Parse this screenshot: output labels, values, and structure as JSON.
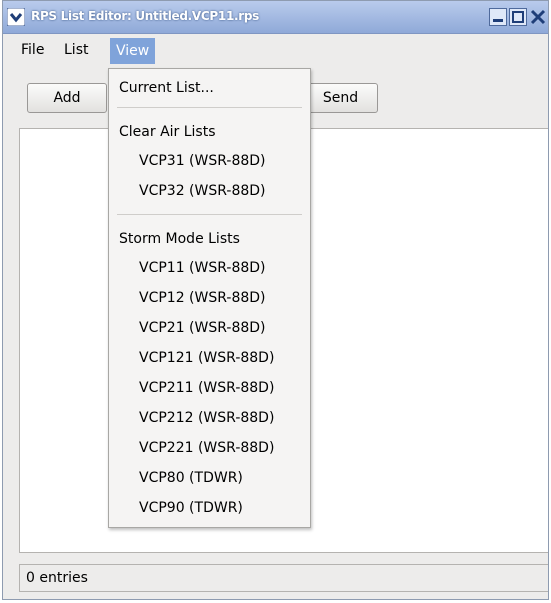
{
  "window": {
    "title": "RPS List Editor: Untitled.VCP11.rps"
  },
  "menubar": {
    "file": "File",
    "list": "List",
    "view": "View"
  },
  "toolbar": {
    "add": "Add",
    "send": "Send"
  },
  "status": {
    "text": "0 entries"
  },
  "view_menu": {
    "current_list": "Current List...",
    "clear_air_header": "Clear Air Lists",
    "clear_air_items": [
      "VCP31 (WSR-88D)",
      "VCP32 (WSR-88D)"
    ],
    "storm_mode_header": "Storm Mode Lists",
    "storm_mode_items": [
      "VCP11 (WSR-88D)",
      "VCP12 (WSR-88D)",
      "VCP21 (WSR-88D)",
      "VCP121 (WSR-88D)",
      "VCP211 (WSR-88D)",
      "VCP212 (WSR-88D)",
      "VCP221 (WSR-88D)",
      "VCP80 (TDWR)",
      "VCP90 (TDWR)"
    ]
  },
  "colors": {
    "titlebar": "#9bb4e0",
    "menu_highlight": "#7fa3da"
  }
}
